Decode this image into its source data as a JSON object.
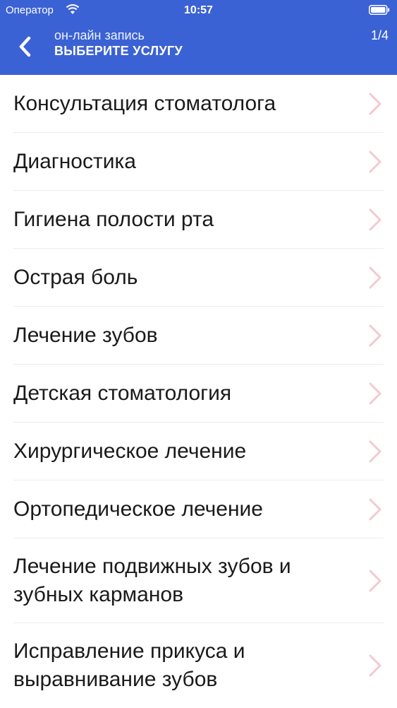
{
  "status_bar": {
    "carrier": "Оператор",
    "time": "10:57"
  },
  "header": {
    "subtitle": "он-лайн запись",
    "title": "ВЫБЕРИТЕ УСЛУГУ",
    "step": "1/4",
    "background_color": "#3b62d4"
  },
  "services": [
    {
      "label": "Консультация стоматолога"
    },
    {
      "label": "Диагностика"
    },
    {
      "label": "Гигиена полости рта"
    },
    {
      "label": "Острая боль"
    },
    {
      "label": "Лечение зубов"
    },
    {
      "label": "Детская стоматология"
    },
    {
      "label": "Хирургическое лечение"
    },
    {
      "label": "Ортопедическое лечение"
    },
    {
      "label": "Лечение подвижных зубов и зубных карманов"
    },
    {
      "label": "Исправление прикуса и выравнивание зубов"
    }
  ],
  "icons": {
    "back": "chevron-left-icon",
    "row": "chevron-right-icon",
    "wifi": "wifi-icon",
    "battery": "battery-icon"
  },
  "colors": {
    "chevron": "#f4c9d0",
    "text": "#1a1a1a",
    "divider": "#ececec"
  }
}
